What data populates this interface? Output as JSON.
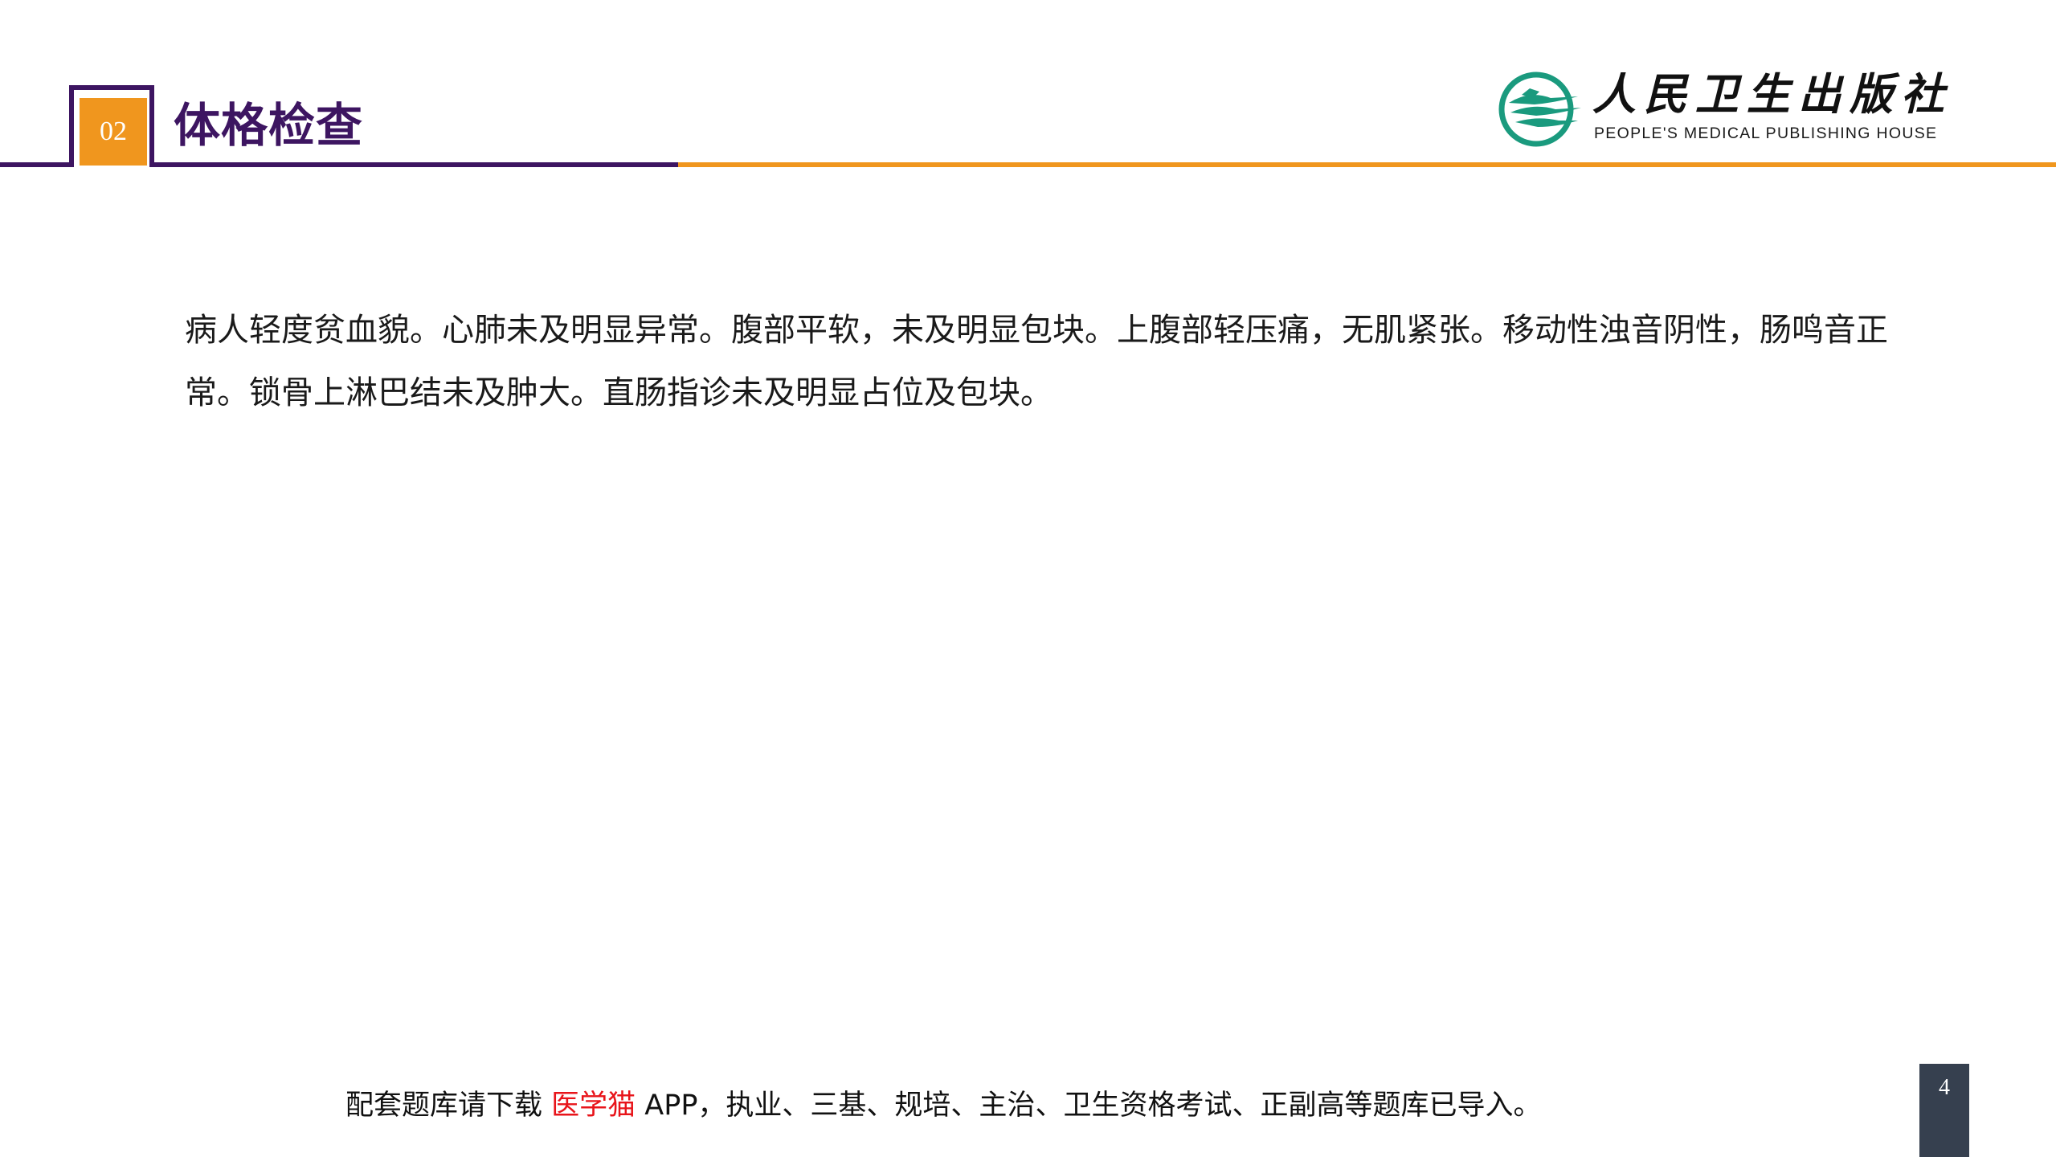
{
  "header": {
    "section_number": "02",
    "title": "体格检查"
  },
  "logo": {
    "name_cn": "人民卫生出版社",
    "name_en": "PEOPLE'S MEDICAL PUBLISHING HOUSE"
  },
  "content": {
    "paragraph": "病人轻度贫血貌。心肺未及明显异常。腹部平软，未及明显包块。上腹部轻压痛，无肌紧张。移动性浊音阴性，肠鸣音正常。锁骨上淋巴结未及肿大。直肠指诊未及明显占位及包块。"
  },
  "footer": {
    "prefix": "配套题库请下载 ",
    "app_name": "医学猫",
    "suffix": " APP，执业、三基、规培、主治、卫生资格考试、正副高等题库已导入。",
    "page_number": "4"
  },
  "colors": {
    "purple": "#3d1561",
    "orange": "#f0961e",
    "teal": "#1a9a7e",
    "app_red": "#e8141a",
    "page_box": "#36404f"
  }
}
